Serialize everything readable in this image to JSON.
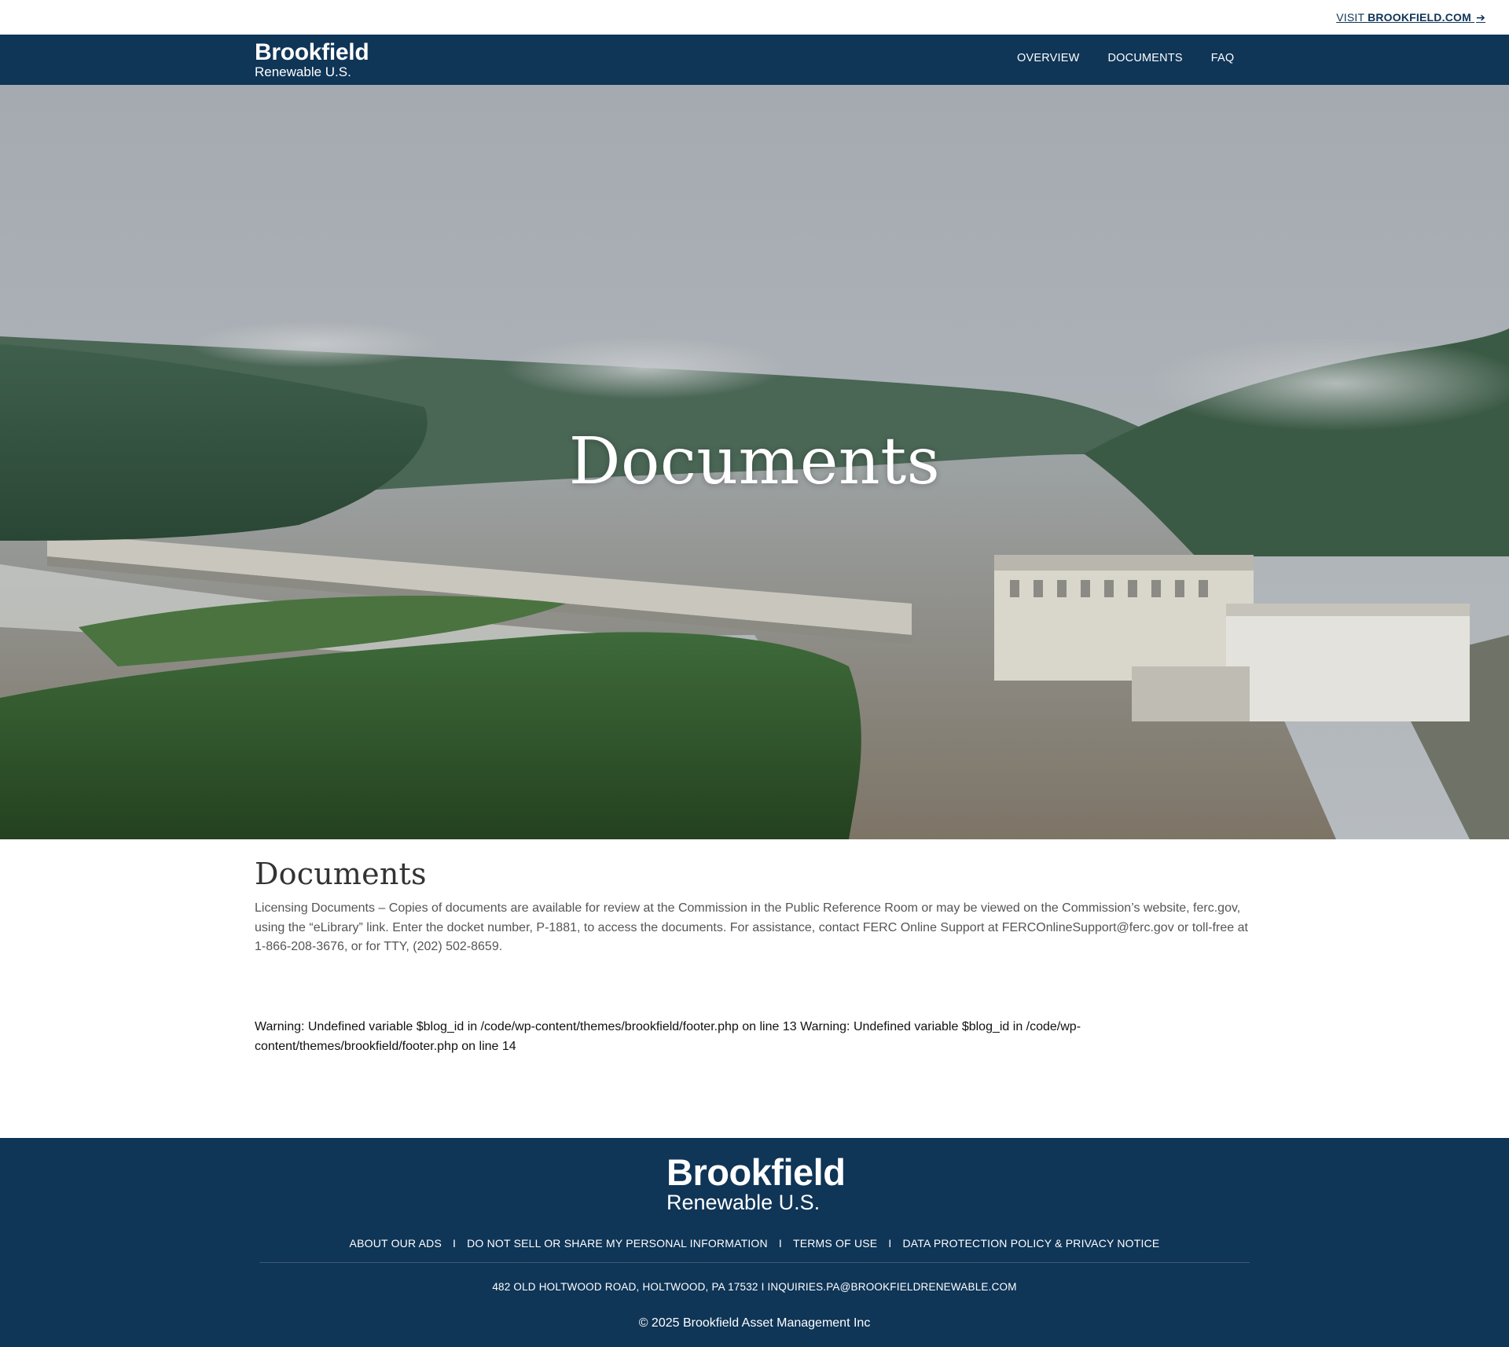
{
  "utility": {
    "visit_prefix": "VISIT ",
    "visit_link": "BROOKFIELD.COM",
    "arrow_icon": "arrow-right-icon"
  },
  "header": {
    "brand_name": "Brookfield",
    "brand_sub": "Renewable U.S.",
    "nav": [
      {
        "label": "OVERVIEW"
      },
      {
        "label": "DOCUMENTS"
      },
      {
        "label": "FAQ"
      }
    ]
  },
  "hero": {
    "title": "Documents"
  },
  "main": {
    "heading": "Documents",
    "description": "Licensing Documents – Copies of documents are available for review at the Commission in the Public Reference Room or may be viewed on the Commission’s website, ferc.gov, using the “eLibrary” link. Enter the docket number, P-1881, to access the documents. For assistance, contact FERC Online Support at FERCOnlineSupport@ferc.gov or toll-free at 1-866-208-3676, or for TTY, (202) 502-8659."
  },
  "warning": {
    "text": "Warning: Undefined variable $blog_id in /code/wp-content/themes/brookfield/footer.php on line 13 Warning: Undefined variable $blog_id in /code/wp-content/themes/brookfield/footer.php on line 14"
  },
  "footer": {
    "brand_name": "Brookfield",
    "brand_sub": "Renewable U.S.",
    "links": [
      {
        "label": "ABOUT OUR ADS"
      },
      {
        "label": "DO NOT SELL OR SHARE MY PERSONAL INFORMATION"
      },
      {
        "label": "TERMS OF USE"
      },
      {
        "label": "DATA PROTECTION POLICY & PRIVACY NOTICE"
      }
    ],
    "separator": "I",
    "address": "482 OLD HOLTWOOD ROAD, HOLTWOOD, PA 17532 I INQUIRIES.PA@BROOKFIELDRENEWABLE.COM",
    "copyright": "© 2025 Brookfield Asset Management Inc"
  },
  "colors": {
    "brand_navy": "#0f3557",
    "white": "#ffffff",
    "body_text": "#555555"
  }
}
